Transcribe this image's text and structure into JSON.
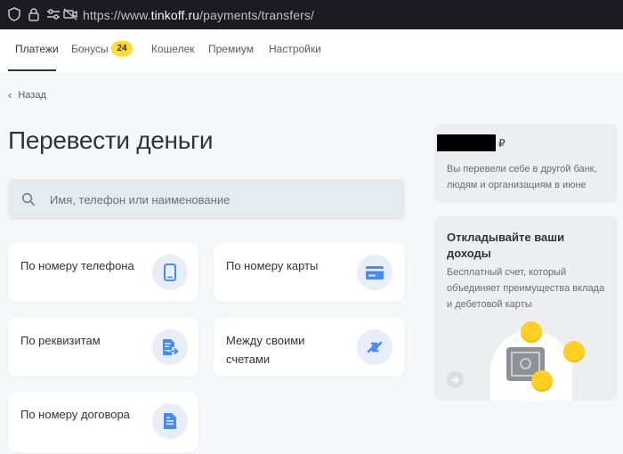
{
  "browser": {
    "url_prefix": "https://www.",
    "url_domain": "tinkoff.ru",
    "url_path": "/payments/transfers/"
  },
  "nav": {
    "items": [
      {
        "label": "Платежи",
        "active": true
      },
      {
        "label": "Бонусы",
        "badge": "24"
      },
      {
        "label": "Кошелек"
      },
      {
        "label": "Премиум"
      },
      {
        "label": "Настройки"
      }
    ]
  },
  "back_label": "Назад",
  "title": "Перевести деньги",
  "search": {
    "placeholder": "Имя, телефон или наименование"
  },
  "transfer_options": [
    {
      "label": "По номеру телефона",
      "icon": "phone-icon"
    },
    {
      "label": "По номеру карты",
      "icon": "card-icon"
    },
    {
      "label": "По реквизитам",
      "icon": "document-arrow-icon"
    },
    {
      "label_line1": "Между своими",
      "label_line2": "счетами",
      "icon": "exchange-arrows-icon"
    },
    {
      "label": "По номеру договора",
      "icon": "document-icon"
    }
  ],
  "summary": {
    "currency": "₽",
    "text_line1": "Вы перевели себе в другой банк,",
    "text_line2": "людям и организациям в июне"
  },
  "promo": {
    "title_line1": "Откладывайте ваши",
    "title_line2": "доходы",
    "text_line1": "Бесплатный счет, который",
    "text_line2": "объединяет преимущества вклада",
    "text_line3": "и дебетовой карты"
  },
  "colors": {
    "accent_blue": "#428bf9",
    "badge_yellow": "#ffdd2d",
    "coin_yellow": "#ffd020"
  }
}
